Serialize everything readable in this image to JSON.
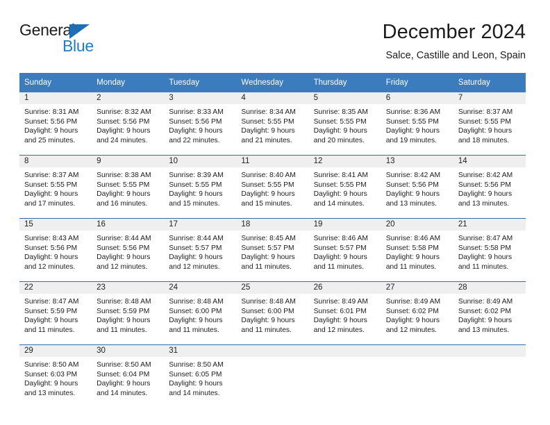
{
  "brand": {
    "name_top": "General",
    "name_bottom": "Blue",
    "color_top": "#1c1c1c",
    "color_bottom": "#1d7ec4",
    "triangle_color": "#1d6fb5"
  },
  "header": {
    "title": "December 2024",
    "location": "Salce, Castille and Leon, Spain"
  },
  "theme": {
    "header_blue": "#3b7cbf",
    "row_divider": "#2f6ca8",
    "daynum_band": "#efefef",
    "text": "#1c1c1c",
    "background": "#ffffff"
  },
  "weekdays": [
    "Sunday",
    "Monday",
    "Tuesday",
    "Wednesday",
    "Thursday",
    "Friday",
    "Saturday"
  ],
  "weeks": [
    [
      {
        "day": "1",
        "sunrise": "Sunrise: 8:31 AM",
        "sunset": "Sunset: 5:56 PM",
        "daylight1": "Daylight: 9 hours",
        "daylight2": "and 25 minutes."
      },
      {
        "day": "2",
        "sunrise": "Sunrise: 8:32 AM",
        "sunset": "Sunset: 5:56 PM",
        "daylight1": "Daylight: 9 hours",
        "daylight2": "and 24 minutes."
      },
      {
        "day": "3",
        "sunrise": "Sunrise: 8:33 AM",
        "sunset": "Sunset: 5:56 PM",
        "daylight1": "Daylight: 9 hours",
        "daylight2": "and 22 minutes."
      },
      {
        "day": "4",
        "sunrise": "Sunrise: 8:34 AM",
        "sunset": "Sunset: 5:55 PM",
        "daylight1": "Daylight: 9 hours",
        "daylight2": "and 21 minutes."
      },
      {
        "day": "5",
        "sunrise": "Sunrise: 8:35 AM",
        "sunset": "Sunset: 5:55 PM",
        "daylight1": "Daylight: 9 hours",
        "daylight2": "and 20 minutes."
      },
      {
        "day": "6",
        "sunrise": "Sunrise: 8:36 AM",
        "sunset": "Sunset: 5:55 PM",
        "daylight1": "Daylight: 9 hours",
        "daylight2": "and 19 minutes."
      },
      {
        "day": "7",
        "sunrise": "Sunrise: 8:37 AM",
        "sunset": "Sunset: 5:55 PM",
        "daylight1": "Daylight: 9 hours",
        "daylight2": "and 18 minutes."
      }
    ],
    [
      {
        "day": "8",
        "sunrise": "Sunrise: 8:37 AM",
        "sunset": "Sunset: 5:55 PM",
        "daylight1": "Daylight: 9 hours",
        "daylight2": "and 17 minutes."
      },
      {
        "day": "9",
        "sunrise": "Sunrise: 8:38 AM",
        "sunset": "Sunset: 5:55 PM",
        "daylight1": "Daylight: 9 hours",
        "daylight2": "and 16 minutes."
      },
      {
        "day": "10",
        "sunrise": "Sunrise: 8:39 AM",
        "sunset": "Sunset: 5:55 PM",
        "daylight1": "Daylight: 9 hours",
        "daylight2": "and 15 minutes."
      },
      {
        "day": "11",
        "sunrise": "Sunrise: 8:40 AM",
        "sunset": "Sunset: 5:55 PM",
        "daylight1": "Daylight: 9 hours",
        "daylight2": "and 15 minutes."
      },
      {
        "day": "12",
        "sunrise": "Sunrise: 8:41 AM",
        "sunset": "Sunset: 5:55 PM",
        "daylight1": "Daylight: 9 hours",
        "daylight2": "and 14 minutes."
      },
      {
        "day": "13",
        "sunrise": "Sunrise: 8:42 AM",
        "sunset": "Sunset: 5:56 PM",
        "daylight1": "Daylight: 9 hours",
        "daylight2": "and 13 minutes."
      },
      {
        "day": "14",
        "sunrise": "Sunrise: 8:42 AM",
        "sunset": "Sunset: 5:56 PM",
        "daylight1": "Daylight: 9 hours",
        "daylight2": "and 13 minutes."
      }
    ],
    [
      {
        "day": "15",
        "sunrise": "Sunrise: 8:43 AM",
        "sunset": "Sunset: 5:56 PM",
        "daylight1": "Daylight: 9 hours",
        "daylight2": "and 12 minutes."
      },
      {
        "day": "16",
        "sunrise": "Sunrise: 8:44 AM",
        "sunset": "Sunset: 5:56 PM",
        "daylight1": "Daylight: 9 hours",
        "daylight2": "and 12 minutes."
      },
      {
        "day": "17",
        "sunrise": "Sunrise: 8:44 AM",
        "sunset": "Sunset: 5:57 PM",
        "daylight1": "Daylight: 9 hours",
        "daylight2": "and 12 minutes."
      },
      {
        "day": "18",
        "sunrise": "Sunrise: 8:45 AM",
        "sunset": "Sunset: 5:57 PM",
        "daylight1": "Daylight: 9 hours",
        "daylight2": "and 11 minutes."
      },
      {
        "day": "19",
        "sunrise": "Sunrise: 8:46 AM",
        "sunset": "Sunset: 5:57 PM",
        "daylight1": "Daylight: 9 hours",
        "daylight2": "and 11 minutes."
      },
      {
        "day": "20",
        "sunrise": "Sunrise: 8:46 AM",
        "sunset": "Sunset: 5:58 PM",
        "daylight1": "Daylight: 9 hours",
        "daylight2": "and 11 minutes."
      },
      {
        "day": "21",
        "sunrise": "Sunrise: 8:47 AM",
        "sunset": "Sunset: 5:58 PM",
        "daylight1": "Daylight: 9 hours",
        "daylight2": "and 11 minutes."
      }
    ],
    [
      {
        "day": "22",
        "sunrise": "Sunrise: 8:47 AM",
        "sunset": "Sunset: 5:59 PM",
        "daylight1": "Daylight: 9 hours",
        "daylight2": "and 11 minutes."
      },
      {
        "day": "23",
        "sunrise": "Sunrise: 8:48 AM",
        "sunset": "Sunset: 5:59 PM",
        "daylight1": "Daylight: 9 hours",
        "daylight2": "and 11 minutes."
      },
      {
        "day": "24",
        "sunrise": "Sunrise: 8:48 AM",
        "sunset": "Sunset: 6:00 PM",
        "daylight1": "Daylight: 9 hours",
        "daylight2": "and 11 minutes."
      },
      {
        "day": "25",
        "sunrise": "Sunrise: 8:48 AM",
        "sunset": "Sunset: 6:00 PM",
        "daylight1": "Daylight: 9 hours",
        "daylight2": "and 11 minutes."
      },
      {
        "day": "26",
        "sunrise": "Sunrise: 8:49 AM",
        "sunset": "Sunset: 6:01 PM",
        "daylight1": "Daylight: 9 hours",
        "daylight2": "and 12 minutes."
      },
      {
        "day": "27",
        "sunrise": "Sunrise: 8:49 AM",
        "sunset": "Sunset: 6:02 PM",
        "daylight1": "Daylight: 9 hours",
        "daylight2": "and 12 minutes."
      },
      {
        "day": "28",
        "sunrise": "Sunrise: 8:49 AM",
        "sunset": "Sunset: 6:02 PM",
        "daylight1": "Daylight: 9 hours",
        "daylight2": "and 13 minutes."
      }
    ],
    [
      {
        "day": "29",
        "sunrise": "Sunrise: 8:50 AM",
        "sunset": "Sunset: 6:03 PM",
        "daylight1": "Daylight: 9 hours",
        "daylight2": "and 13 minutes."
      },
      {
        "day": "30",
        "sunrise": "Sunrise: 8:50 AM",
        "sunset": "Sunset: 6:04 PM",
        "daylight1": "Daylight: 9 hours",
        "daylight2": "and 14 minutes."
      },
      {
        "day": "31",
        "sunrise": "Sunrise: 8:50 AM",
        "sunset": "Sunset: 6:05 PM",
        "daylight1": "Daylight: 9 hours",
        "daylight2": "and 14 minutes."
      },
      {
        "day": "",
        "sunrise": "",
        "sunset": "",
        "daylight1": "",
        "daylight2": ""
      },
      {
        "day": "",
        "sunrise": "",
        "sunset": "",
        "daylight1": "",
        "daylight2": ""
      },
      {
        "day": "",
        "sunrise": "",
        "sunset": "",
        "daylight1": "",
        "daylight2": ""
      },
      {
        "day": "",
        "sunrise": "",
        "sunset": "",
        "daylight1": "",
        "daylight2": ""
      }
    ]
  ]
}
